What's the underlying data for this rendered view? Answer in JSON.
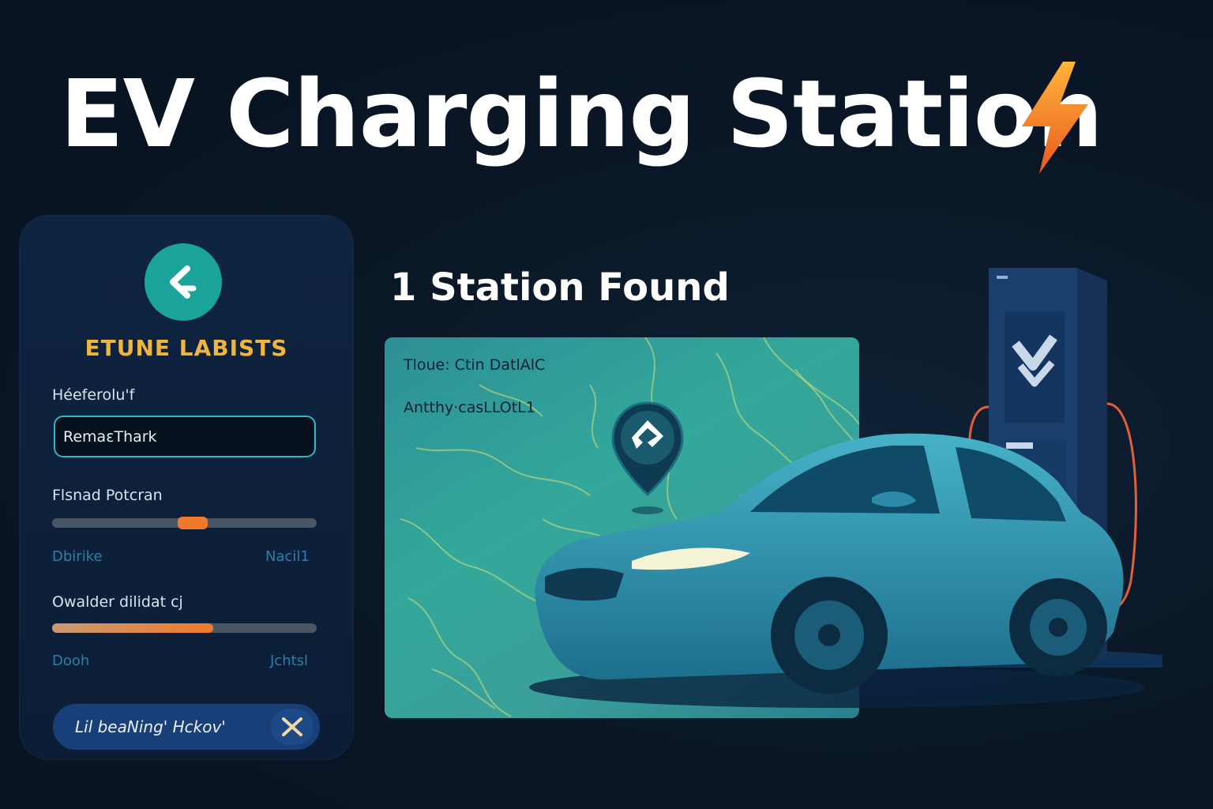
{
  "header": {
    "title": "EV Charging Station",
    "icon": "lightning-bolt-icon",
    "accent": "#f07a2a"
  },
  "filter_panel": {
    "back_icon": "chevron-left-icon",
    "heading": "ETUNE LABISTS",
    "input_label": "Héeferolu'f",
    "input_value": "RemaɛThark",
    "slider1": {
      "label": "Flsnad Potcran",
      "value": 0.53,
      "min_label": "Dbirike",
      "max_label": "Nacil1"
    },
    "slider2": {
      "label": "Owalder dilidat cj",
      "value": 0.61,
      "min_label": "Dooh",
      "max_label": "Jchtsl"
    },
    "button_label": "Lil beaNing' Hckov'",
    "button_icon": "close-icon"
  },
  "results": {
    "count_text": "1 Station Found"
  },
  "map_card": {
    "line1": "Tloue:  Ctin DatlAlC",
    "line2": "Antthy·casLLOtL1",
    "pin_icon": "location-pin-icon"
  },
  "colors": {
    "background": "#0a1726",
    "panel": "#0f2440",
    "teal": "#1aa39a",
    "heading_gold": "#f0b53a",
    "slider_orange": "#f07a2a",
    "map_teal": "#33a89a"
  }
}
